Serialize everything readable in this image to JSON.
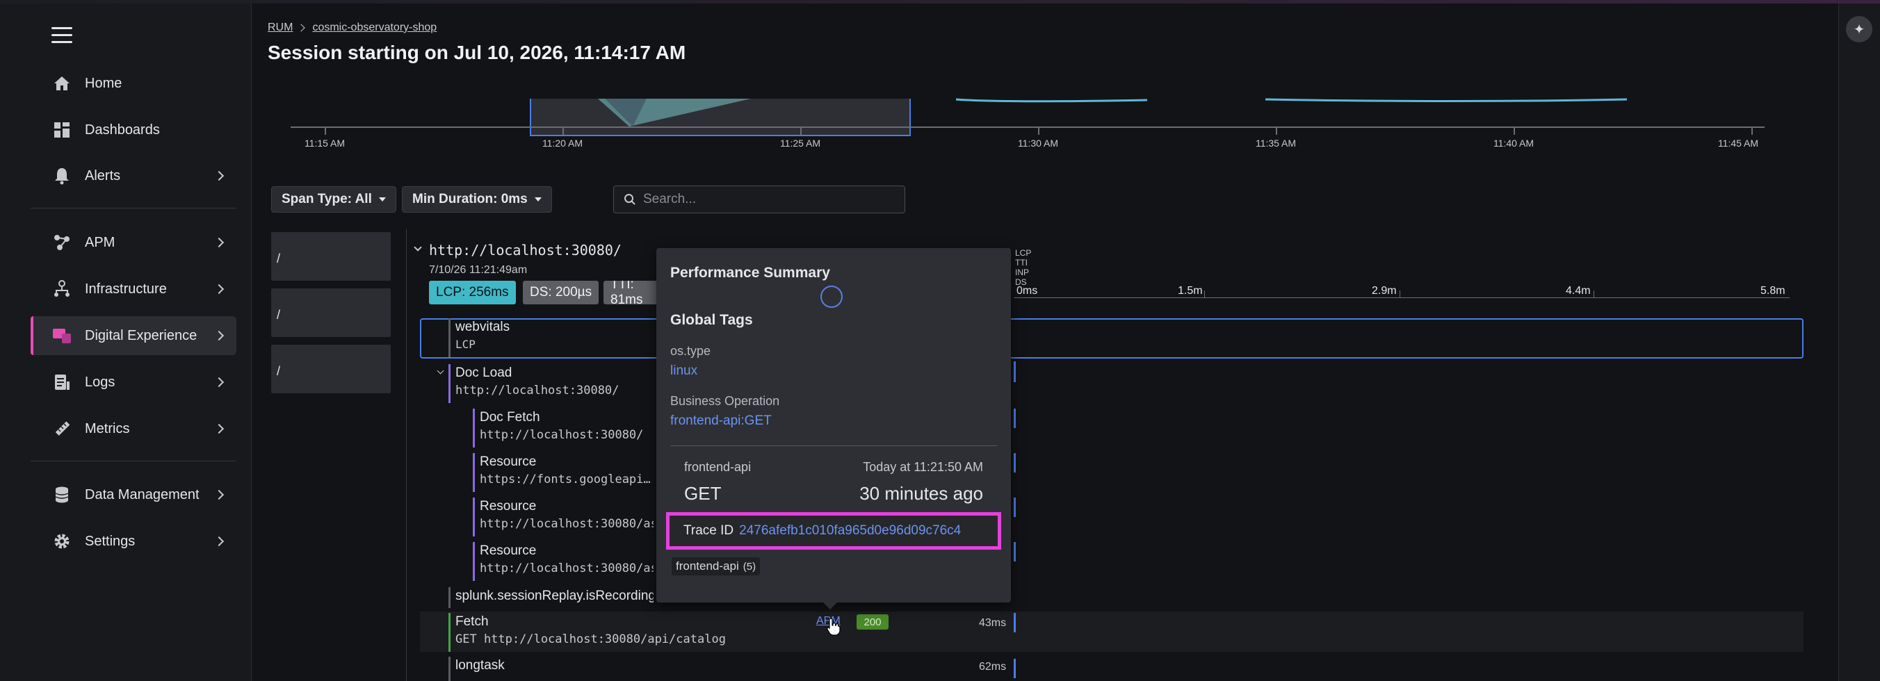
{
  "sidebar": {
    "items": [
      {
        "label": "Home",
        "icon": "home-icon"
      },
      {
        "label": "Dashboards",
        "icon": "dashboards-icon"
      },
      {
        "label": "Alerts",
        "icon": "bell-icon"
      },
      {
        "label": "APM",
        "icon": "apm-icon"
      },
      {
        "label": "Infrastructure",
        "icon": "infrastructure-icon"
      },
      {
        "label": "Digital Experience",
        "icon": "digital-experience-icon"
      },
      {
        "label": "Logs",
        "icon": "logs-icon"
      },
      {
        "label": "Metrics",
        "icon": "metrics-icon"
      },
      {
        "label": "Data Management",
        "icon": "database-icon"
      },
      {
        "label": "Settings",
        "icon": "gear-icon"
      }
    ],
    "active": "Digital Experience"
  },
  "breadcrumb": {
    "root": "RUM",
    "app": "cosmic-observatory-shop"
  },
  "page_title": "Session starting on Jul 10, 2026, 11:14:17 AM",
  "timeline": {
    "ticks": [
      "11:15 AM",
      "11:20 AM",
      "11:25 AM",
      "11:30 AM",
      "11:35 AM",
      "11:40 AM",
      "11:45 AM"
    ]
  },
  "filters": {
    "span_type": "Span Type: All",
    "min_duration": "Min Duration: 0ms",
    "search_placeholder": "Search..."
  },
  "pages": [
    "/",
    "/",
    "/"
  ],
  "root": {
    "url": "http://localhost:30080/",
    "date": "7/10/26 11:21:49am",
    "pills": {
      "lcp": "LCP: 256ms",
      "ds": "DS: 200µs",
      "tti": "TTI: 81ms"
    }
  },
  "waterfall": {
    "legend": [
      "LCP",
      "TTI",
      "INP",
      "DS"
    ],
    "ticks": [
      "0ms",
      "1.5m",
      "2.9m",
      "4.4m",
      "5.8m"
    ]
  },
  "spans": [
    {
      "name": "webvitals",
      "sub": "LCP"
    },
    {
      "name": "Doc Load",
      "sub": "http://localhost:30080/"
    },
    {
      "name": "Doc Fetch",
      "sub": "http://localhost:30080/"
    },
    {
      "name": "Resource",
      "sub": "https://fonts.googleapi… ys"
    },
    {
      "name": "Resource",
      "sub": "http://localhost:30080/ass"
    },
    {
      "name": "Resource",
      "sub": "http://localhost:30080/ass"
    },
    {
      "name": "splunk.sessionReplay.isRecording",
      "sub": ""
    },
    {
      "name": "Fetch",
      "sub": "GET http://localhost:30080/api/catalog"
    },
    {
      "name": "longtask",
      "sub": ""
    }
  ],
  "fetch_row": {
    "apm": "APM",
    "status": "200",
    "duration": "43ms"
  },
  "longtask_duration": "62ms",
  "tooltip": {
    "title": "Performance Summary",
    "global_tags": "Global Tags",
    "os_key": "os.type",
    "os_val": "linux",
    "biz_key": "Business Operation",
    "biz_val": "frontend-api:GET",
    "service": "frontend-api",
    "time": "Today at 11:21:50 AM",
    "method": "GET",
    "ago": "30 minutes ago",
    "trace_label": "Trace ID",
    "trace_id": "2476afefb1c010fa965d0e96d09c76c4",
    "chip": "frontend-api",
    "chip_count": "(5)"
  },
  "colors": {
    "accent": "#e54db3",
    "highlight": "#e640dd",
    "link": "#6b93f0",
    "lcp": "#41b8c7"
  }
}
